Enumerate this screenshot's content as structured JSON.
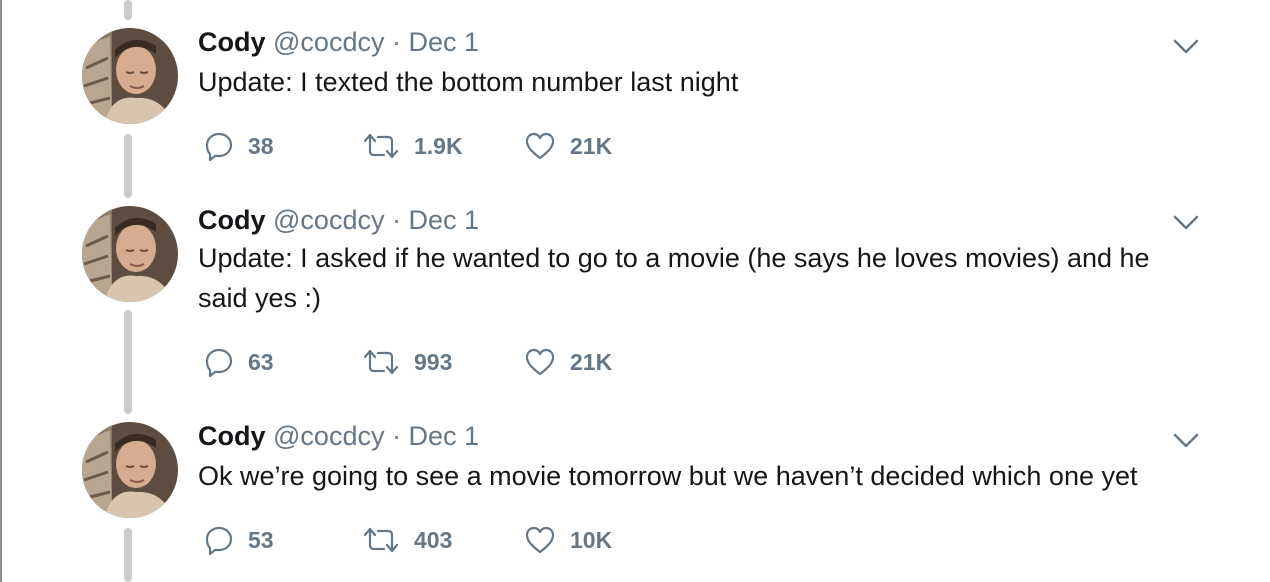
{
  "tweets": [
    {
      "name": "Cody",
      "handle": "@cocdcy",
      "separator": "·",
      "date": "Dec 1",
      "text_lines": [
        "Update: I texted the bottom number last night"
      ],
      "replies": "38",
      "retweets": "1.9K",
      "likes": "21K"
    },
    {
      "name": "Cody",
      "handle": "@cocdcy",
      "separator": "·",
      "date": "Dec 1",
      "text_lines": [
        "Update: I asked if he wanted to go to a movie (he says he loves movies) and he",
        "said yes :)"
      ],
      "replies": "63",
      "retweets": "993",
      "likes": "21K"
    },
    {
      "name": "Cody",
      "handle": "@cocdcy",
      "separator": "·",
      "date": "Dec 1",
      "text_lines": [
        "Ok we’re going to see a movie tomorrow but we haven’t decided which one yet"
      ],
      "replies": "53",
      "retweets": "403",
      "likes": "10K"
    }
  ],
  "icons": {
    "reply": "reply-icon",
    "retweet": "retweet-icon",
    "like": "heart-icon",
    "more": "chevron-down-icon"
  },
  "colors": {
    "text": "#14171a",
    "secondary": "#657786",
    "thread_line": "#c8ccd0"
  }
}
